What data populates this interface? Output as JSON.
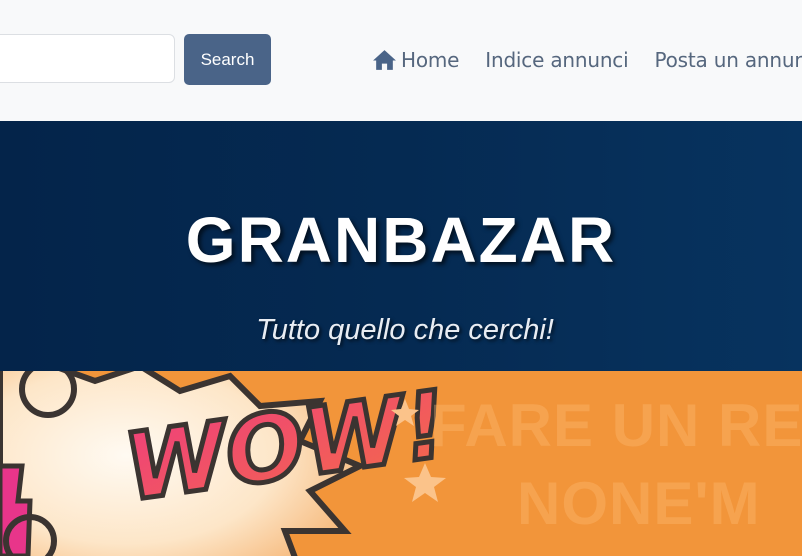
{
  "search": {
    "placeholder": "",
    "value": "",
    "button_label": "Search"
  },
  "nav": {
    "items": [
      {
        "label": "Home",
        "icon": "home-icon"
      },
      {
        "label": "Indice annunci"
      },
      {
        "label": "Posta un annuncio"
      }
    ]
  },
  "hero": {
    "title": "GRANBAZAR",
    "subtitle": "Tutto quello che cerchi!"
  },
  "banner": {
    "comic_word": "WOW!",
    "line1": "FARE UN RES",
    "line2": "NONE'M"
  },
  "colors": {
    "accent": "#4a6488",
    "hero_bg": "#052a52",
    "banner_bg": "#f2953a"
  }
}
